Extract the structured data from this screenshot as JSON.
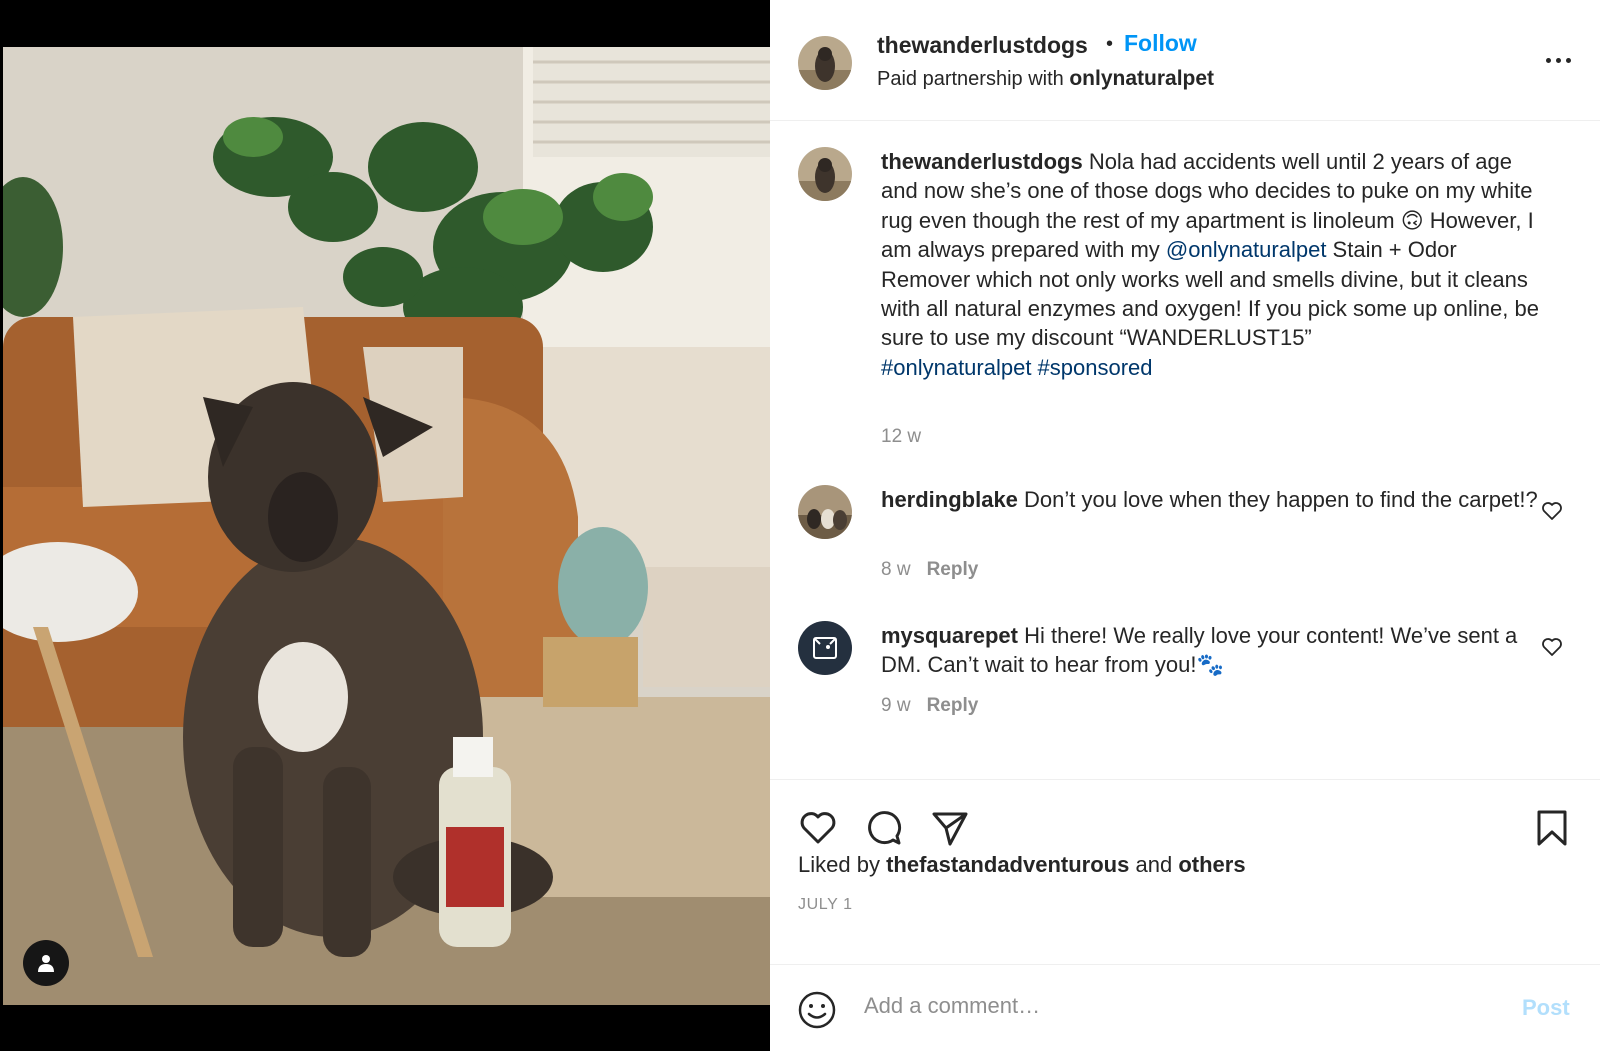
{
  "post": {
    "author": "thewanderlustdogs",
    "follow_label": "Follow",
    "partnership_prefix": "Paid partnership with",
    "partner": "onlynaturalpet",
    "more_icon": "more-horizontal-icon"
  },
  "caption": {
    "user": "thewanderlustdogs",
    "text_1": "Nola had accidents well until 2 years of age and now she’s one of those dogs who decides to puke on my white rug even though the rest of my apartment is linoleum ",
    "emoji": "🙃",
    "text_2": " However, I am always prepared with my ",
    "mention": "@onlynaturalpet",
    "text_3": " Stain + Odor Remover which not only works well and smells divine, but it cleans with all natural enzymes and oxygen! If you pick some up online, be sure to use my discount “WANDERLUST15”",
    "hashtags": "#onlynaturalpet #sponsored",
    "time": "12 w"
  },
  "comments": [
    {
      "user": "herdingblake",
      "text": "Don’t you love when they happen to find the carpet!?",
      "time": "8 w",
      "reply_label": "Reply"
    },
    {
      "user": "mysquarepet",
      "text": "Hi there! We really love your content! We’ve sent a DM. Can’t wait to hear from you!🐾",
      "time": "9 w",
      "reply_label": "Reply"
    }
  ],
  "likes": {
    "prefix": "Liked by",
    "user": "thefastandadventurous",
    "middle": "and",
    "others": "others"
  },
  "date": "JULY 1",
  "add_comment": {
    "placeholder": "Add a comment…",
    "post_label": "Post"
  },
  "colors": {
    "accent": "#0095f6",
    "mention": "#00376b",
    "post_disabled": "#b2dffc",
    "muted": "#8e8e8e"
  }
}
